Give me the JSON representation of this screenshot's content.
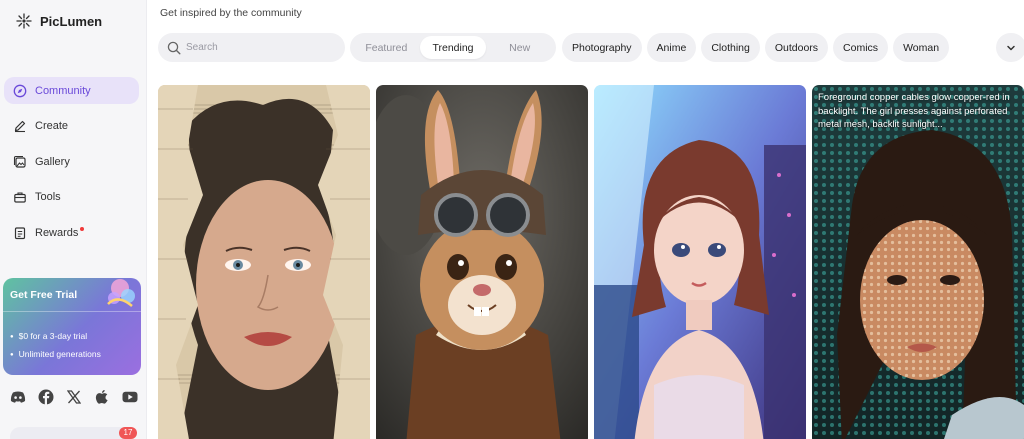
{
  "brand": {
    "name": "PicLumen"
  },
  "nav": [
    {
      "label": "Community",
      "icon": "compass-icon",
      "active": true
    },
    {
      "label": "Create",
      "icon": "pen-icon"
    },
    {
      "label": "Gallery",
      "icon": "gallery-icon"
    },
    {
      "label": "Tools",
      "icon": "toolbox-icon"
    },
    {
      "label": "Rewards",
      "icon": "clipboard-icon",
      "dot": true
    }
  ],
  "trial": {
    "title": "Get Free Trial",
    "items": [
      "$0 for a 3-day trial",
      "Unlimited generations"
    ]
  },
  "socials": [
    "discord-icon",
    "facebook-icon",
    "x-icon",
    "apple-icon",
    "youtube-icon"
  ],
  "notification_count": "17",
  "header": {
    "subtitle": "Get inspired by the community"
  },
  "search": {
    "placeholder": "Search",
    "value": ""
  },
  "sort_tabs": [
    {
      "label": "Featured"
    },
    {
      "label": "Trending",
      "active": true
    },
    {
      "label": "New"
    }
  ],
  "categories": [
    "Photography",
    "Anime",
    "Clothing",
    "Outdoors",
    "Comics",
    "Woman"
  ],
  "cards": [
    {
      "subject": "woman-torn-sheet-music"
    },
    {
      "subject": "aviator-rabbit"
    },
    {
      "subject": "anime-girl-neon-city"
    },
    {
      "subject": "woman-mesh-shadow",
      "caption": "Foreground copper cables glow copper-red in backlight. The girl presses against perforated metal mesh, backlit sunlight..."
    }
  ],
  "colors": {
    "accent": "#6a49d9",
    "active_bg": "#e8e2f9",
    "badge": "#f05656"
  }
}
